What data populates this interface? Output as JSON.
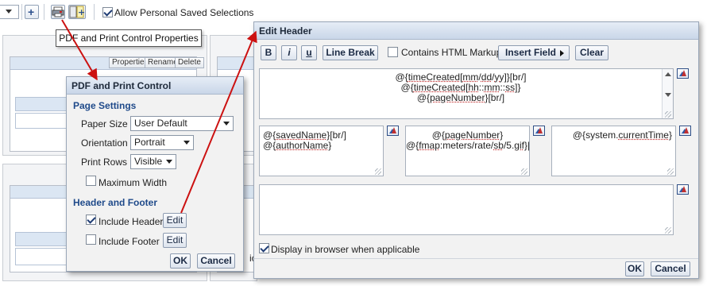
{
  "toolbar": {
    "allow_personal_saved_selections_label": "Allow Personal Saved Selections",
    "allow_personal_saved_selections_checked": true
  },
  "tooltip": {
    "text": "PDF and Print Control Properties"
  },
  "background_panel": {
    "buttons": {
      "properties": "Properties",
      "rename": "Rename",
      "delete": "Delete"
    },
    "peek_letter": "ic"
  },
  "pdf_dialog": {
    "title": "PDF and Print Control",
    "page_settings_title": "Page Settings",
    "paper_size_label": "Paper Size",
    "paper_size_value": "User Default",
    "orientation_label": "Orientation",
    "orientation_value": "Portrait",
    "print_rows_label": "Print Rows",
    "print_rows_value": "Visible",
    "maximum_width_label": "Maximum Width",
    "maximum_width_checked": false,
    "header_footer_title": "Header and Footer",
    "include_header_label": "Include Header",
    "include_header_checked": true,
    "include_footer_label": "Include Footer",
    "include_footer_checked": false,
    "edit_label": "Edit",
    "ok_label": "OK",
    "cancel_label": "Cancel"
  },
  "edit_header_dialog": {
    "title": "Edit Header",
    "bold_label": "B",
    "italic_label": "i",
    "underline_label": "u",
    "line_break_label": "Line Break",
    "contains_html_label": "Contains HTML Markup",
    "contains_html_checked": false,
    "insert_field_label": "Insert Field",
    "clear_label": "Clear",
    "top_area_lines": [
      "@{timeCreated[mm/dd/yy]}[br/]",
      "@{timeCreated[hh::mm::ss]}",
      "@{pageNumber}[br/]"
    ],
    "left_area_lines": [
      "@{savedName}[br/]",
      "@{authorName}"
    ],
    "center_area_lines": [
      "@{pageNumber}",
      "@{fmap:meters/rate/sb/5.gif}"
    ],
    "right_area_lines": [
      "@{system.currentTime}"
    ],
    "display_in_browser_label": "Display in browser when applicable",
    "display_in_browser_checked": true,
    "ok_label": "OK",
    "cancel_label": "Cancel"
  },
  "colors": {
    "arrow": "#cc1111",
    "section_title": "#1f4a8a",
    "title_bar": "#c9d6e8"
  }
}
